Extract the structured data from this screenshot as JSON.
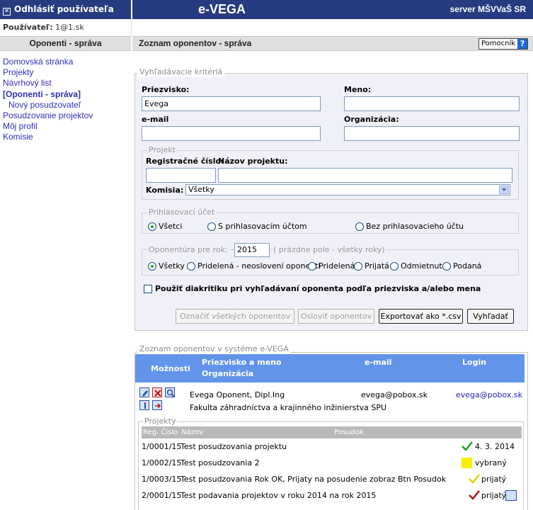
{
  "header": {
    "logout_label": "Odhlásiť používateľa",
    "app_title": "e-VEGA",
    "server_label": "server MŠVVaŠ SR"
  },
  "user": {
    "label": "Používateľ:",
    "value": "1@1.sk"
  },
  "section": {
    "left_title": "Oponenti - správa",
    "right_title": "Zoznam oponentov - správa",
    "help_label": "Pomocník",
    "help_icon": "?"
  },
  "menu": {
    "items": [
      "Domovská stránka",
      "Projekty",
      "Návrhový list",
      "[Oponenti - správa]",
      "Nový posudzovateľ",
      "Posudzovanie projektov",
      "Môj profil",
      "Komisie"
    ]
  },
  "criteria": {
    "legend": "Vyhľadávacie kritériá",
    "surname_label": "Priezvisko:",
    "surname_value": "Evega",
    "name_label": "Meno:",
    "name_value": "",
    "email_label": "e-mail",
    "email_value": "",
    "org_label": "Organizácia:",
    "org_value": "",
    "project": {
      "legend": "Projekt",
      "reg_label": "Registračné číslo:",
      "name_label": "Názov projektu:",
      "commission_label": "Komisia:",
      "commission_value": "Všetky"
    },
    "login_account": {
      "legend": "Prihlasovací účet",
      "options": [
        "Všetci",
        "S prihlasovacím účtom",
        "Bez prihlasovacieho účtu"
      ]
    },
    "year": {
      "legend": "Oponentúra pre rok:",
      "value": "2015",
      "hint": "( prázdne pole - všetky roky)",
      "options": [
        "Všetky",
        "Pridelená - neoslovení oponenti",
        "Pridelená",
        "Prijatá",
        "Odmietnutá",
        "Podaná"
      ]
    },
    "diacritics_label": "Použiť diakritiku pri vyhľadávaní oponenta podľa priezviska a/alebo mena",
    "buttons": {
      "mark_all": "Označiť všetkých oponentov",
      "address": "Osloviť oponentov",
      "export": "Exportovať ako *.csv",
      "search": "Vyhľadať"
    }
  },
  "list": {
    "legend": "Zoznam oponentov v systéme e-VEGA",
    "columns": {
      "options": "Možnosti",
      "name_org_1": "Priezvisko a meno",
      "name_org_2": "Organizácia",
      "email": "e-mail",
      "login": "Login"
    },
    "row": {
      "name": "Evega Oponent, Dipl.Ing",
      "org": "Fakulta záhradníctva a krajinného inžinierstva SPU",
      "email": "evega@pobox.sk",
      "login": "evega@pobox.sk"
    },
    "projects": {
      "legend": "Projekty",
      "col_reg": "Reg. Číslo",
      "col_name": "Názov",
      "col_review": "Posudok",
      "rows": [
        {
          "reg": "1/0001/15",
          "name": "Test posudzovania projektu",
          "status": "4. 3. 2014"
        },
        {
          "reg": "1/0002/15",
          "name": "Test posudzovania 2",
          "status": "vybraný"
        },
        {
          "reg": "1/0003/15",
          "name": "Test posudzovania Rok OK, Prijaty na posudenie zobraz Btn Posudok",
          "status": "prijatý"
        },
        {
          "reg": "2/0001/15",
          "name": "Test podavania projektov v roku 2014 na rok 2015",
          "status": "prijatý"
        }
      ]
    }
  },
  "colors": {
    "header_bg": "#273b80",
    "list_header_bg": "#6294ea",
    "link": "#2f2fb8",
    "check_green": "#21a121",
    "check_yellow": "#e0d000",
    "check_red": "#c01010",
    "selected_yellow": "#f8f000"
  }
}
